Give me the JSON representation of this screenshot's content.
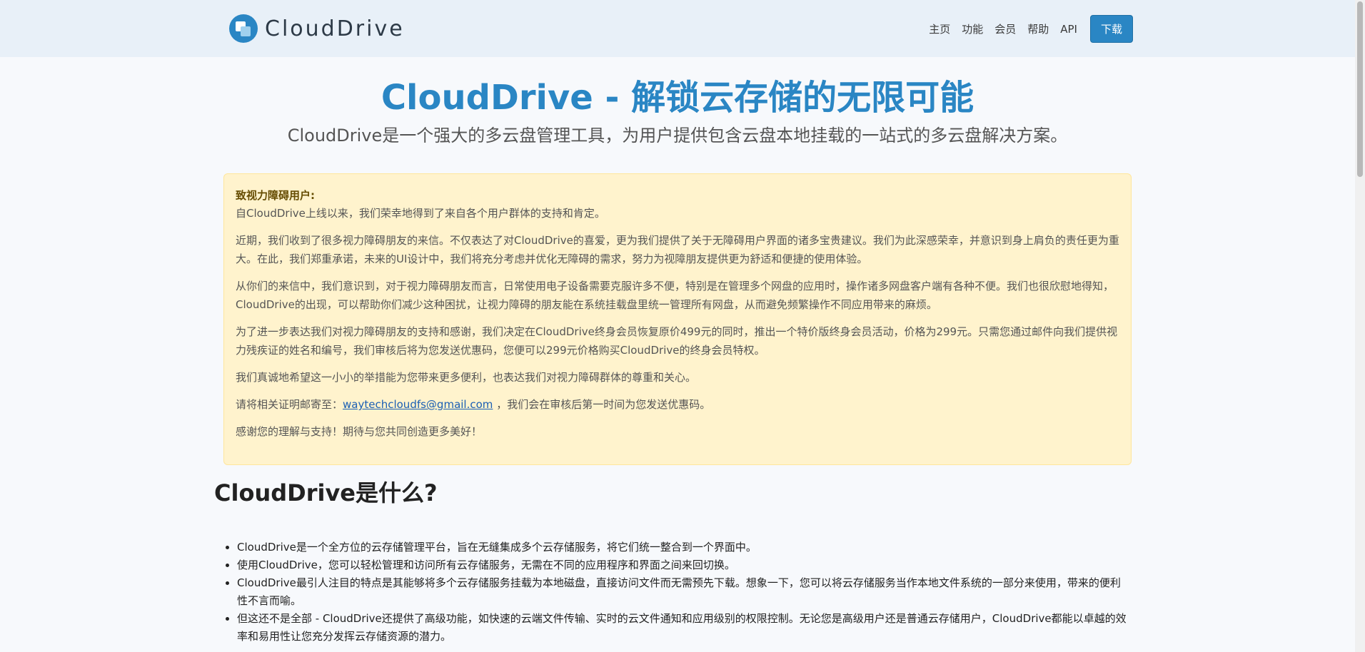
{
  "nav": {
    "brand": "CloudDrive",
    "links": [
      "主页",
      "功能",
      "会员",
      "帮助",
      "API"
    ],
    "download": "下载"
  },
  "hero": {
    "title": "CloudDrive - 解锁云存储的无限可能",
    "subtitle": "CloudDrive是一个强大的多云盘管理工具，为用户提供包含云盘本地挂载的一站式的多云盘解决方案。"
  },
  "notice": {
    "title": "致视力障碍用户:",
    "p1": "自CloudDrive上线以来，我们荣幸地得到了来自各个用户群体的支持和肯定。",
    "p2": "近期，我们收到了很多视力障碍朋友的来信。不仅表达了对CloudDrive的喜爱，更为我们提供了关于无障碍用户界面的诸多宝贵建议。我们为此深感荣幸，并意识到身上肩负的责任更为重大。在此，我们郑重承诺，未来的UI设计中，我们将充分考虑并优化无障碍的需求，努力为视障朋友提供更为舒适和便捷的使用体验。",
    "p3": "从你们的来信中，我们意识到，对于视力障碍朋友而言，日常使用电子设备需要克服许多不便，特别是在管理多个网盘的应用时，操作诸多网盘客户端有各种不便。我们也很欣慰地得知，CloudDrive的出现，可以帮助你们减少这种困扰，让视力障碍的朋友能在系统挂载盘里统一管理所有网盘，从而避免频繁操作不同应用带来的麻烦。",
    "p4": "为了进一步表达我们对视力障碍朋友的支持和感谢，我们决定在CloudDrive终身会员恢复原价499元的同时，推出一个特价版终身会员活动，价格为299元。只需您通过邮件向我们提供视力残疾证的姓名和编号，我们审核后将为您发送优惠码，您便可以299元价格购买CloudDrive的终身会员特权。",
    "p5": "我们真诚地希望这一小小的举措能为您带来更多便利，也表达我们对视力障碍群体的尊重和关心。",
    "p6_before": "请将相关证明邮寄至：",
    "email": "waytechcloudfs@gmail.com",
    "p6_after": "，我们会在审核后第一时间为您发送优惠码。",
    "p7": "感谢您的理解与支持！期待与您共同创造更多美好！"
  },
  "section": {
    "title": "CloudDrive是什么?"
  },
  "features": [
    "CloudDrive是一个全方位的云存储管理平台，旨在无缝集成多个云存储服务，将它们统一整合到一个界面中。",
    "使用CloudDrive，您可以轻松管理和访问所有云存储服务，无需在不同的应用程序和界面之间来回切换。",
    "CloudDrive最引人注目的特点是其能够将多个云存储服务挂载为本地磁盘，直接访问文件而无需预先下载。想象一下，您可以将云存储服务当作本地文件系统的一部分来使用，带来的便利性不言而喻。",
    "但这还不是全部 - CloudDrive还提供了高级功能，如快速的云端文件传输、实时的云文件通知和应用级别的权限控制。无论您是高级用户还是普通云存储用户，CloudDrive都能以卓越的效率和易用性让您充分发挥云存储资源的潜力。"
  ]
}
